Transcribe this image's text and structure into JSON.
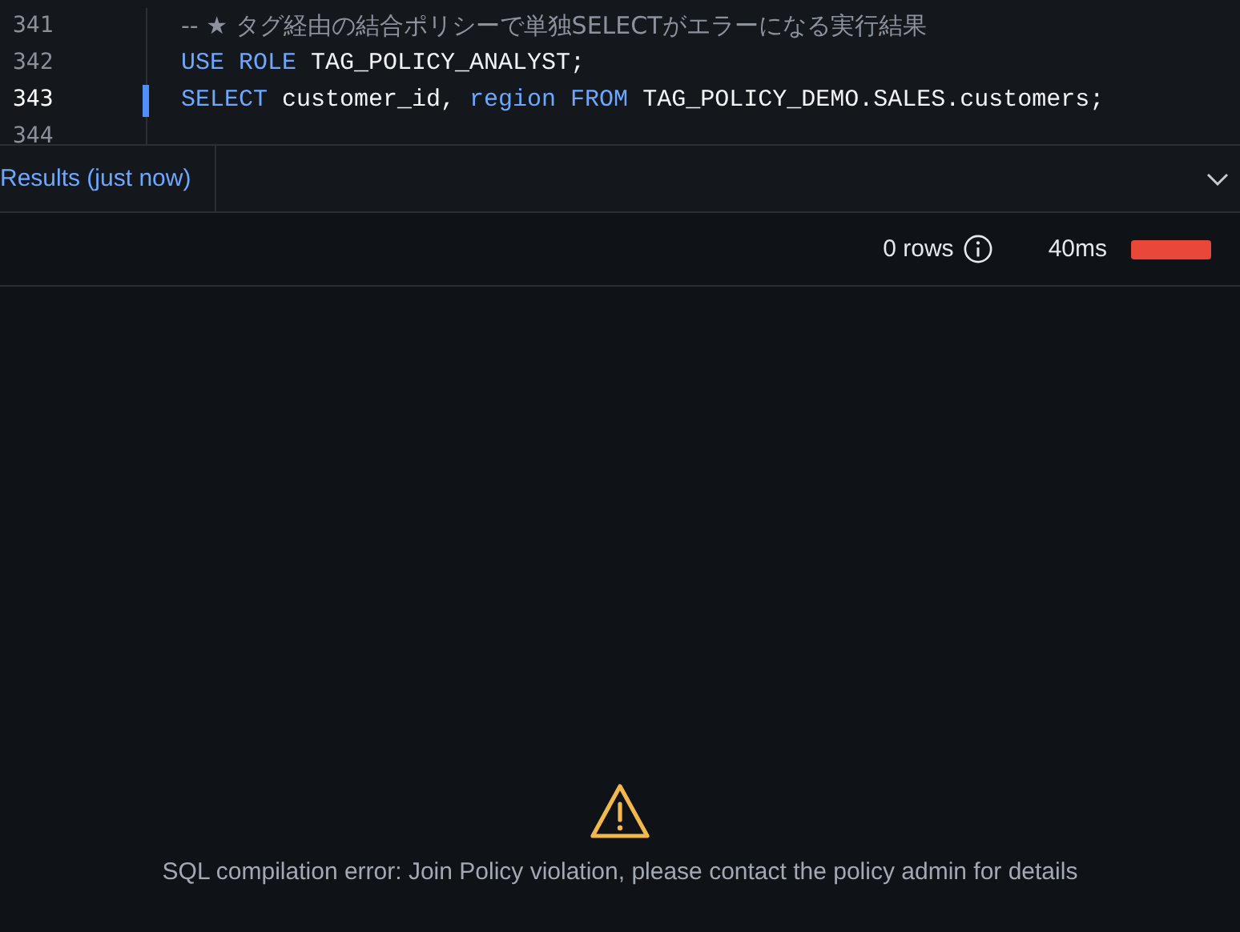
{
  "editor": {
    "lines": [
      {
        "number": "341",
        "current": false,
        "tokens": [
          {
            "kind": "comment",
            "text": "-- ★ タグ経由の結合ポリシーで単独SELECTがエラーになる実行結果"
          }
        ]
      },
      {
        "number": "342",
        "current": false,
        "tokens": [
          {
            "kind": "keyword",
            "text": "USE ROLE"
          },
          {
            "kind": "plain",
            "text": " TAG_POLICY_ANALYST;"
          }
        ]
      },
      {
        "number": "343",
        "current": true,
        "tokens": [
          {
            "kind": "keyword",
            "text": "SELECT"
          },
          {
            "kind": "plain",
            "text": " customer_id, "
          },
          {
            "kind": "keyword",
            "text": "region FROM"
          },
          {
            "kind": "plain",
            "text": " TAG_POLICY_DEMO.SALES.customers;"
          }
        ]
      },
      {
        "number": "344",
        "current": false
      }
    ]
  },
  "results": {
    "tab": "Results (just now)",
    "row_count": "0 rows",
    "duration": "40ms",
    "error": "SQL compilation error: Join Policy violation, please contact the policy admin for details"
  }
}
